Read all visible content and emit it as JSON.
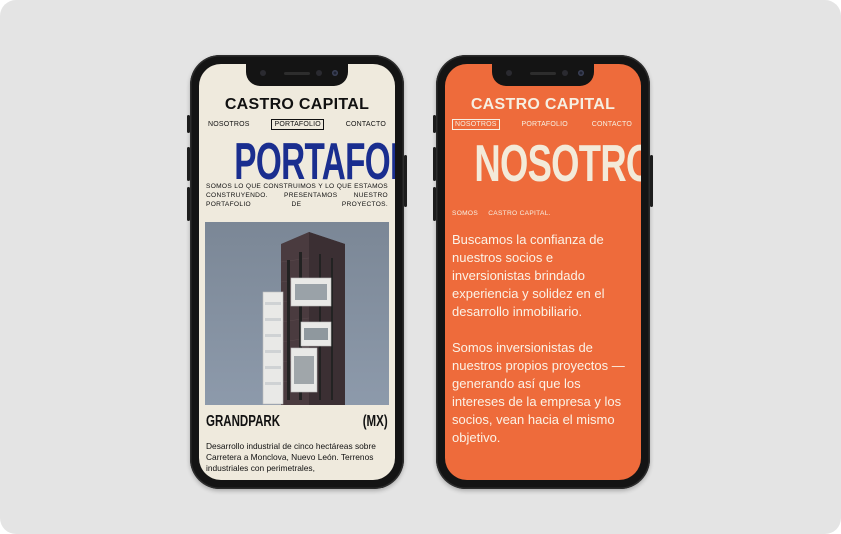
{
  "left_phone": {
    "brand": "CASTRO CAPITAL",
    "nav": [
      "NOSOTROS",
      "PORTAFOLIO",
      "CONTACTO"
    ],
    "active_nav": "PORTAFOLIO",
    "title": "PORTAFOLIO",
    "intro": "SOMOS LO QUE CONSTRUIMOS Y LO QUE ESTAMOS CONSTRUYENDO. PRESENTAMOS NUESTRO PORTAFOLIO DE PROYECTOS.",
    "project": {
      "name": "GRANDPARK",
      "country": "(MX)",
      "description": "Desarrollo industrial de cinco hectáreas sobre Carretera a Monclova, Nuevo León. Terrenos industriales con perimetrales,"
    },
    "colors": {
      "background": "#efeadd",
      "title": "#1a2e8f"
    }
  },
  "right_phone": {
    "brand": "CASTRO CAPITAL",
    "nav": [
      "NOSOTROS",
      "PORTAFOLIO",
      "CONTACTO"
    ],
    "active_nav": "NOSOTROS",
    "title": "NOSOTROS",
    "tagline_words": [
      "SOMOS",
      "CASTRO CAPITAL."
    ],
    "paragraph_1": "Buscamos la confianza de nuestros socios e inversionistas brindado experiencia y solidez en el desarrollo inmobiliario.",
    "paragraph_2": "Somos inversionistas de nuestros propios proyectos — generando así que los intereses de la empresa y los socios, vean hacia el mismo objetivo.",
    "colors": {
      "background": "#ee6b3b",
      "text": "#f6efe2"
    }
  }
}
